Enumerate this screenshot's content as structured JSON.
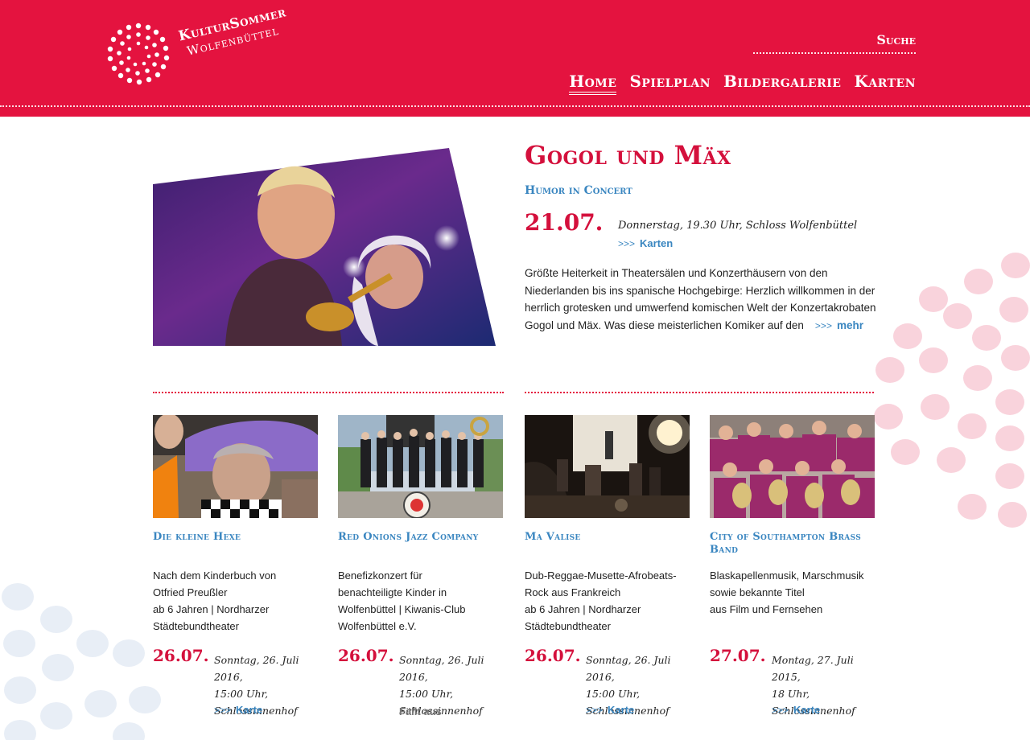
{
  "brand": {
    "line1": "KulturSommer",
    "line2": "Wolfenbüttel",
    "red": "#e4133f",
    "blue": "#3a86c0"
  },
  "header": {
    "search_label": "Suche",
    "nav": [
      {
        "label": "Home",
        "active": true
      },
      {
        "label": "Spielplan",
        "active": false
      },
      {
        "label": "Bildergalerie",
        "active": false
      },
      {
        "label": "Karten",
        "active": false
      }
    ]
  },
  "featured": {
    "title": "Gogol und Mäx",
    "subtitle": "Humor in Concert",
    "date": "21.07.",
    "when": "Donnerstag, 19.30 Uhr, Schloss Wolfenbüttel",
    "tickets_arrow": ">>>",
    "tickets_label": "Karten",
    "body": "Größte Heiterkeit in Theatersälen und Konzerthäusern von den Niederlanden bis ins spanische Hochgebirge: Herzlich willkommen in der herrlich grotesken und umwerfend komischen Welt der Konzertakrobaten Gogol und Mäx. Was diese meisterlichen Komiker auf den",
    "more_arrow": ">>>",
    "more_label": "mehr"
  },
  "events": [
    {
      "title": "Die kleine Hexe",
      "desc": [
        "Nach dem Kinderbuch von",
        "Otfried Preußler",
        "ab 6 Jahren | Nordharzer",
        "Städtebundtheater"
      ],
      "date": "26.07.",
      "when": [
        "Sonntag, 26. Juli 2016,",
        "15:00 Uhr,",
        "Schlossinnenhof"
      ],
      "link_arrow": ">>>",
      "link_label": "Karte"
    },
    {
      "title": "Red Onions Jazz Company",
      "desc": [
        "Benefizkonzert für",
        "benachteiligte Kinder in",
        "Wolfenbüttel | Kiwanis-Club",
        "Wolfenbüttel e.V."
      ],
      "date": "26.07.",
      "when": [
        "Sonntag, 26. Juli 2016,",
        "15:00 Uhr,",
        "Schlossinnenhof"
      ],
      "status": "Fällt aus"
    },
    {
      "title": "Ma Valise",
      "desc": [
        "Dub-Reggae-Musette-Afrobeats-",
        "Rock aus Frankreich",
        "ab 6 Jahren | Nordharzer",
        "Städtebundtheater"
      ],
      "date": "26.07.",
      "when": [
        "Sonntag, 26. Juli 2016,",
        "15:00 Uhr,",
        "Schlossinnenhof"
      ],
      "link_arrow": ">>>",
      "link_label": "Karte"
    },
    {
      "title": "City of Southampton Brass Band",
      "desc": [
        "Blaskapellenmusik, Marschmusik",
        "sowie bekannte Titel",
        "aus Film und Fernsehen"
      ],
      "date": "27.07.",
      "when": [
        "Montag, 27. Juli 2015,",
        "18 Uhr,",
        "Schlossinnenhof"
      ],
      "link_arrow": ">>>",
      "link_label": "Karte"
    }
  ]
}
